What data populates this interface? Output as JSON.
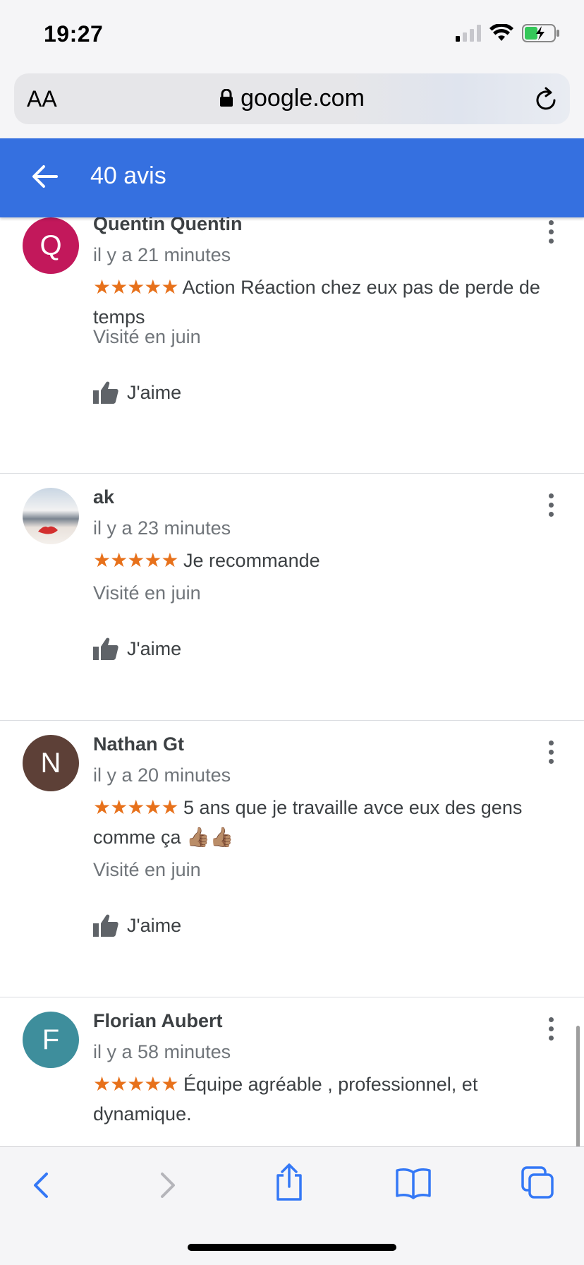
{
  "status_bar": {
    "time": "19:27"
  },
  "browser": {
    "text_size_label": "AA",
    "url": "google.com"
  },
  "header": {
    "title": "40 avis"
  },
  "reviews": [
    {
      "initial": "Q",
      "avatar_color": "#c2185b",
      "author": "Quentin Quentin",
      "time": "il y a 21 minutes",
      "stars": "★★★★★",
      "text": "Action Réaction chez eux pas de perde de temps",
      "visited": "Visité en juin",
      "like_label": "J'aime"
    },
    {
      "initial": "",
      "avatar_color": "#b0bcc8",
      "author": "ak",
      "time": "il y a 23 minutes",
      "stars": "★★★★★",
      "text": "Je recommande",
      "visited": "Visité en juin",
      "like_label": "J'aime"
    },
    {
      "initial": "N",
      "avatar_color": "#5d4037",
      "author": "Nathan Gt",
      "time": "il y a 20 minutes",
      "stars": "★★★★★",
      "text": "5 ans que je travaille avce eux des gens comme ça 👍🏽👍🏽",
      "visited": "Visité en juin",
      "like_label": "J'aime"
    },
    {
      "initial": "F",
      "avatar_color": "#3e8e9c",
      "author": "Florian Aubert",
      "time": "il y a 58 minutes",
      "stars": "★★★★★",
      "text": "Équipe agréable , professionnel, et dynamique.",
      "visited": "",
      "like_label": ""
    }
  ],
  "colors": {
    "accent": "#3570e0",
    "star": "#e7711b"
  },
  "toolbar_icons": [
    "back-icon",
    "forward-icon",
    "share-icon",
    "bookmarks-icon",
    "tabs-icon"
  ]
}
